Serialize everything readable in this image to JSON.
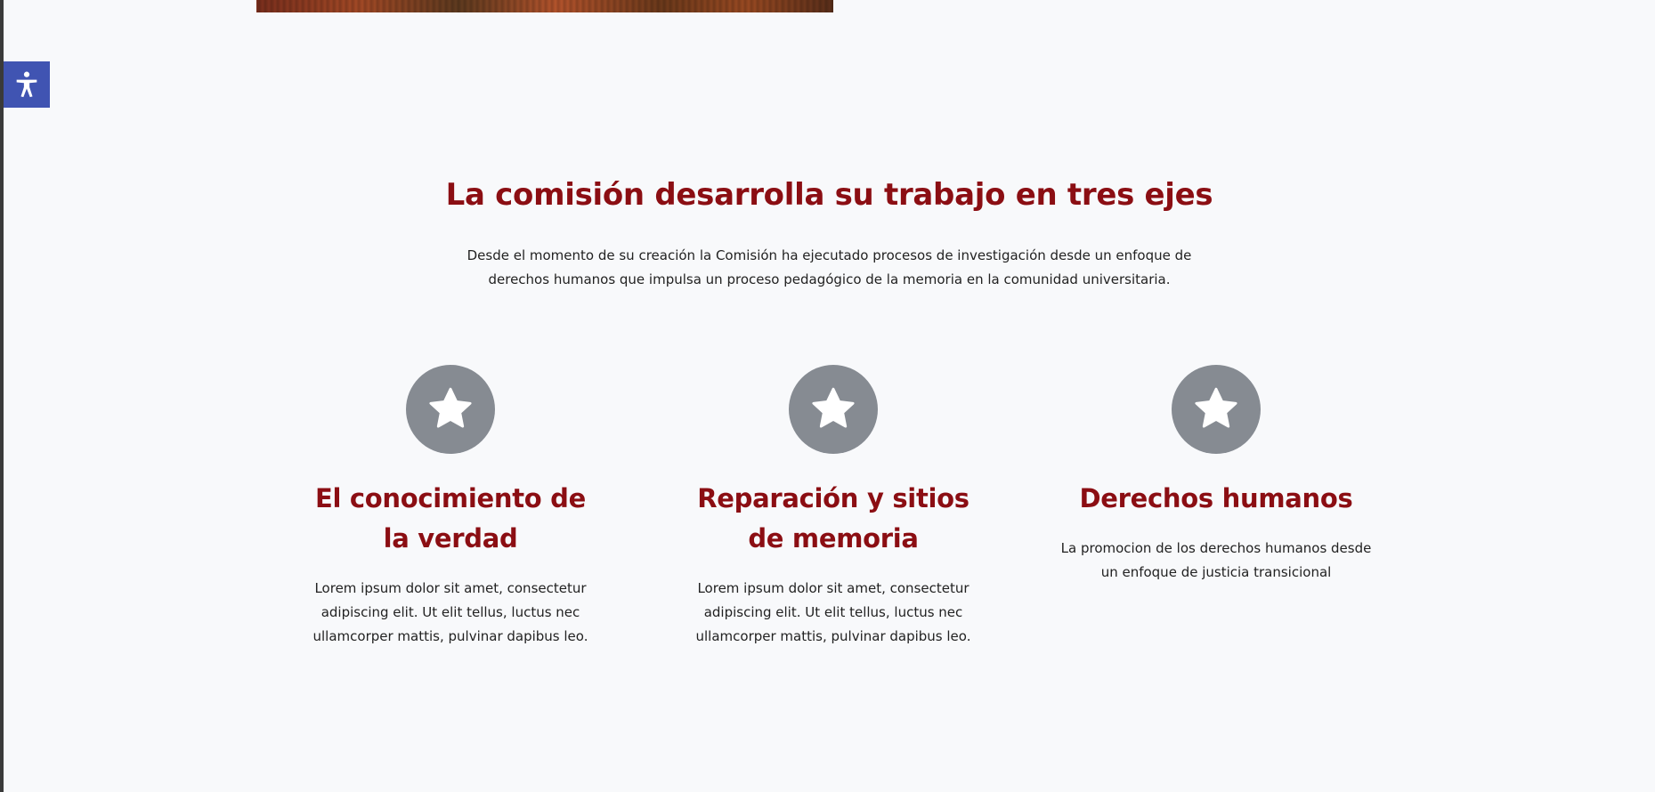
{
  "accessibility": {
    "icon": "accessibility-person-icon",
    "color": "#4054b2"
  },
  "section": {
    "title": "La comisión desarrolla su trabajo en tres ejes",
    "intro": "Desde el momento de su creación la Comisión ha ejecutado procesos de investigación desde un enfoque de derechos humanos que impulsa un proceso pedagógico de la memoria en la comunidad universitaria."
  },
  "features": [
    {
      "icon": "star-icon",
      "title": "El conocimiento de la verdad",
      "text": "Lorem ipsum dolor sit amet, consectetur adipiscing elit. Ut elit tellus, luctus nec ullamcorper mattis, pulvinar dapibus leo."
    },
    {
      "icon": "star-icon",
      "title": "Reparación y sitios de memoria",
      "text": "Lorem ipsum dolor sit amet, consectetur adipiscing elit. Ut elit tellus, luctus nec ullamcorper mattis, pulvinar dapibus leo."
    },
    {
      "icon": "star-icon",
      "title": "Derechos humanos",
      "text": "La promocion de los derechos humanos desde un enfoque de justicia transicional"
    }
  ],
  "colors": {
    "heading": "#8b0e13",
    "badge": "#868b92",
    "background": "#f8f9fb",
    "body_text": "#222222"
  }
}
